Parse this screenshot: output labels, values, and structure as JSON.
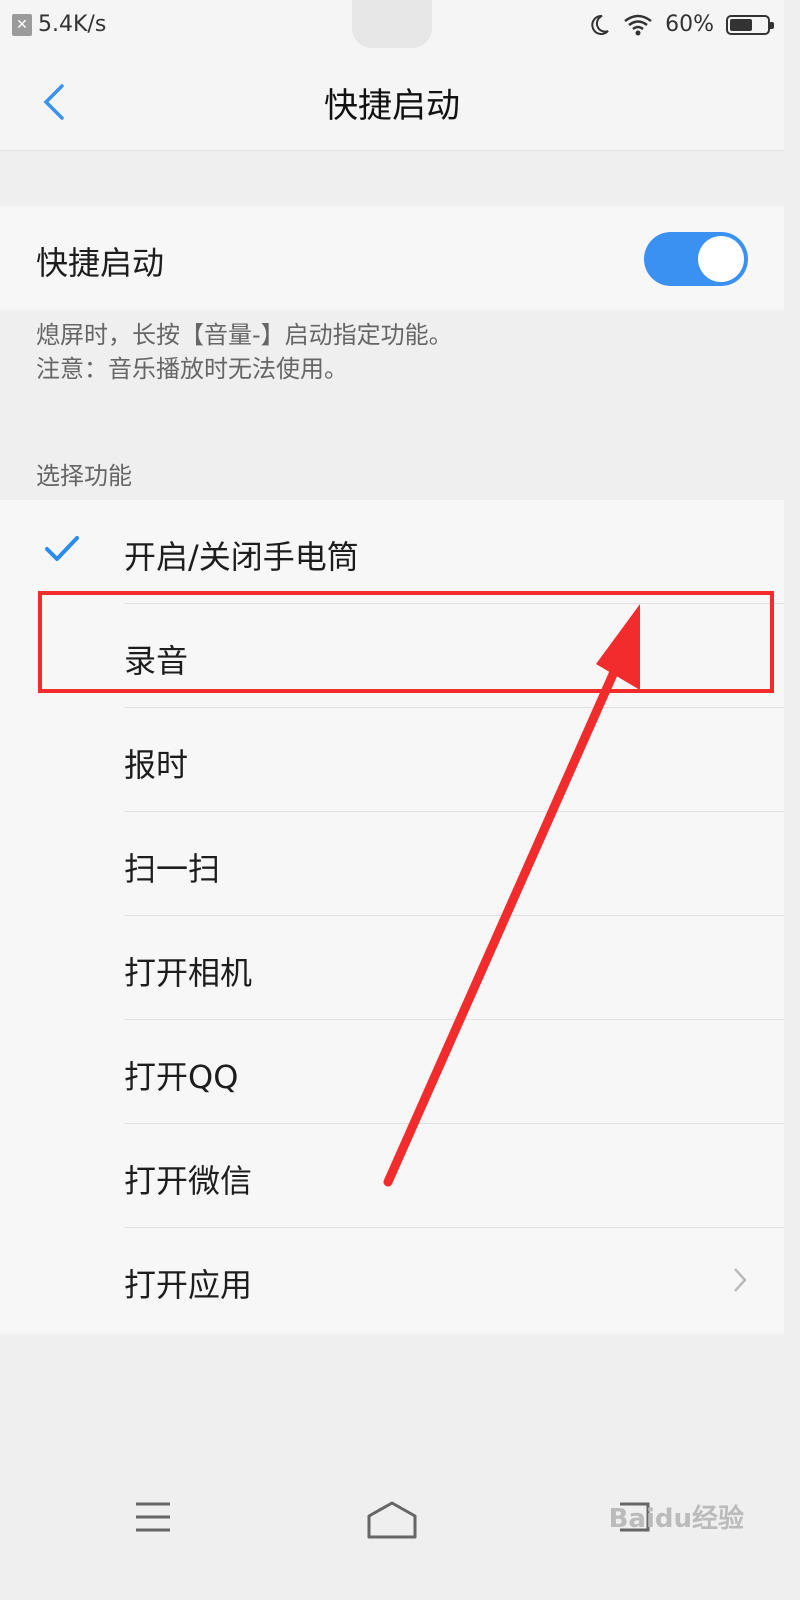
{
  "status_bar": {
    "speed": "5.4K/s",
    "battery_text": "60%",
    "battery_level": 0.6,
    "icons": [
      "close-icon",
      "moon-icon",
      "wifi-icon",
      "battery-icon"
    ]
  },
  "header": {
    "title": "快捷启动",
    "back_icon": "chevron-left-icon"
  },
  "toggle_row": {
    "label": "快捷启动",
    "enabled": true,
    "accent": "#3a91f2"
  },
  "description": {
    "line1": "熄屏时，长按【音量-】启动指定功能。",
    "line2": "注意：音乐播放时无法使用。"
  },
  "section_title": "选择功能",
  "functions": [
    {
      "label": "开启/关闭手电筒",
      "selected": true
    },
    {
      "label": "录音",
      "selected": false,
      "highlighted": true
    },
    {
      "label": "报时",
      "selected": false
    },
    {
      "label": "扫一扫",
      "selected": false
    },
    {
      "label": "打开相机",
      "selected": false
    },
    {
      "label": "打开QQ",
      "selected": false
    },
    {
      "label": "打开微信",
      "selected": false
    },
    {
      "label": "打开应用",
      "selected": false,
      "has_chevron": true
    }
  ],
  "annotation": {
    "highlight_color": "#f22c2c"
  },
  "navbar": {
    "icons": [
      "menu-icon",
      "home-icon",
      "back-icon"
    ]
  },
  "watermark": "Baidu经验"
}
